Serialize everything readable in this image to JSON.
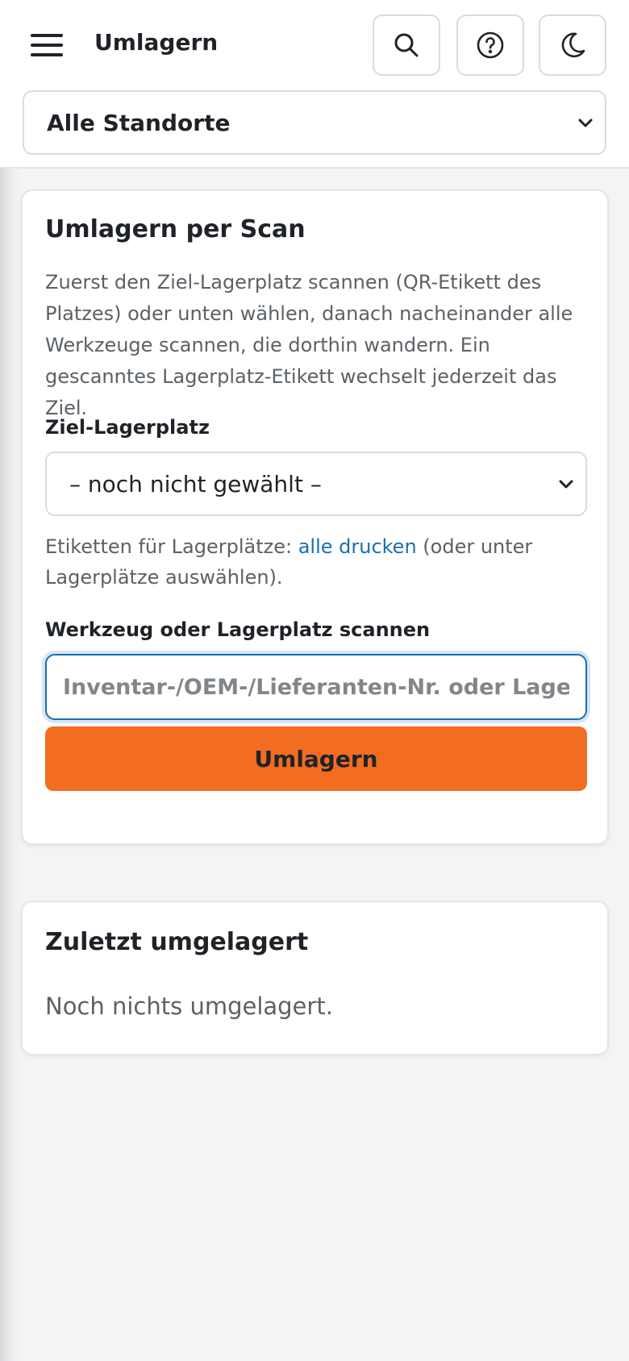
{
  "header": {
    "title": "Umlagern",
    "location_select": "Alle Standorte"
  },
  "scan_card": {
    "title": "Umlagern per Scan",
    "intro": "Zuerst den Ziel-Lagerplatz scannen (QR-Etikett des Platzes) oder unten wählen, danach nacheinander alle Werkzeuge scannen, die dorthin wandern. Ein gescanntes Lagerplatz-Etikett wechselt jederzeit das Ziel.",
    "target_label": "Ziel-Lagerplatz",
    "target_value": "– noch nicht gewählt –",
    "hint_before": "Etiketten für Lagerplätze: ",
    "hint_link": "alle drucken",
    "hint_after": " (oder unter Lagerplätze auswählen).",
    "scan_label": "Werkzeug oder Lagerplatz scannen",
    "scan_placeholder": "Inventar-/OEM-/Lieferanten-Nr. oder Lagerplatz",
    "submit_label": "Umlagern"
  },
  "recent_card": {
    "title": "Zuletzt umgelagert",
    "empty": "Noch nichts umgelagert."
  },
  "colors": {
    "accent": "#f26d21",
    "link": "#1a6fb0",
    "focus": "#1a6fb0"
  },
  "icons": [
    "menu-icon",
    "search-icon",
    "help-icon",
    "moon-icon",
    "chevron-down-icon"
  ]
}
